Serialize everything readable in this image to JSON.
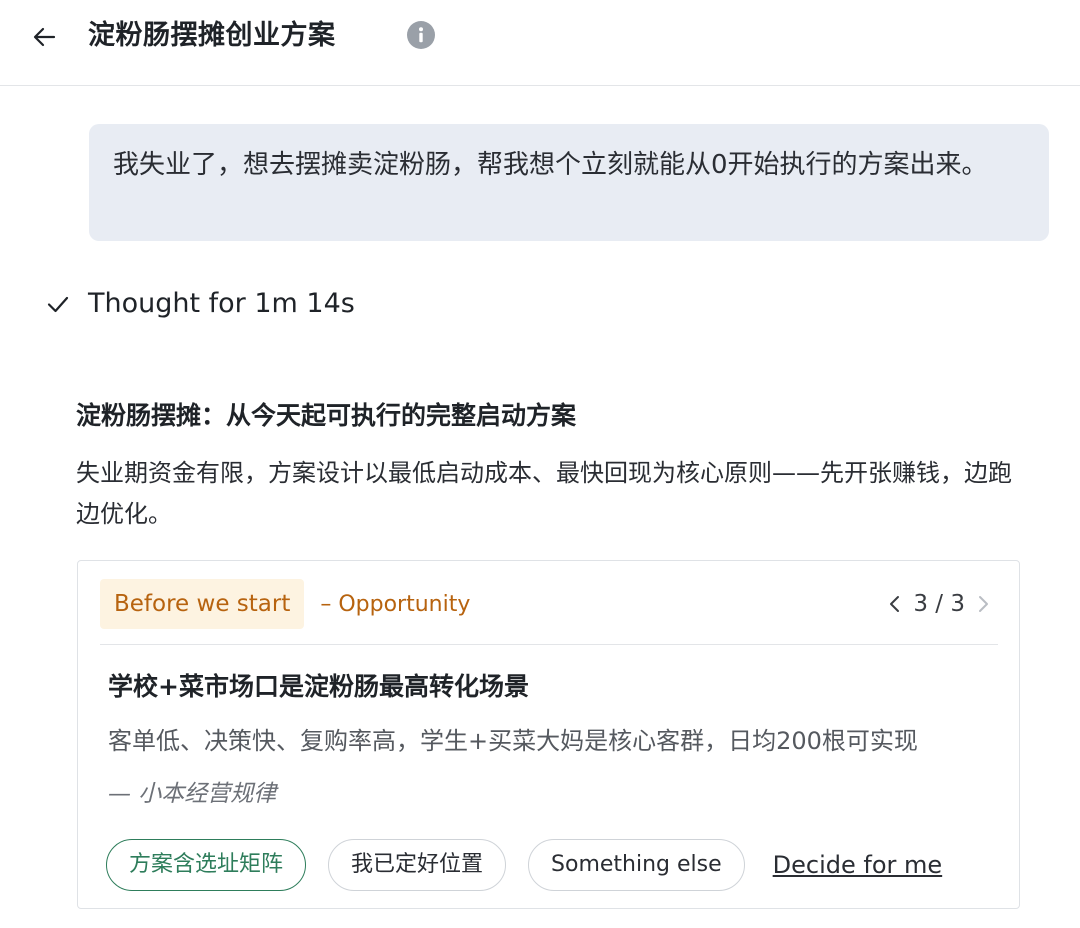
{
  "header": {
    "title": "淀粉肠摆摊创业方案",
    "back_icon": "arrow-left-icon",
    "info_icon": "info-icon"
  },
  "user_message": {
    "text": "我失业了，想去摆摊卖淀粉肠，帮我想个立刻就能从0开始执行的方案出来。"
  },
  "thought": {
    "icon": "check-icon",
    "label": "Thought for 1m 14s"
  },
  "response": {
    "title": "淀粉肠摆摊：从今天起可执行的完整启动方案",
    "body": "失业期资金有限，方案设计以最低启动成本、最快回现为核心原则——先开张赚钱，边跑边优化。"
  },
  "card": {
    "tag": "Before we start",
    "subtag": "– Opportunity",
    "pager": "3 / 3",
    "title": "学校+菜市场口是淀粉肠最高转化场景",
    "body": "客单低、决策快、复购率高，学生+买菜大妈是核心客群，日均200根可实现",
    "source": "— 小本经营规律",
    "options": [
      {
        "label": "方案含选址矩阵"
      },
      {
        "label": "我已定好位置"
      },
      {
        "label": "Something else"
      }
    ],
    "link_label": "Decide for me"
  },
  "colors": {
    "accent_green": "#2e7d5b",
    "tag_orange": "#b7630f",
    "tag_bg": "#fdf3e1",
    "bubble_bg": "#e8ecf3"
  }
}
